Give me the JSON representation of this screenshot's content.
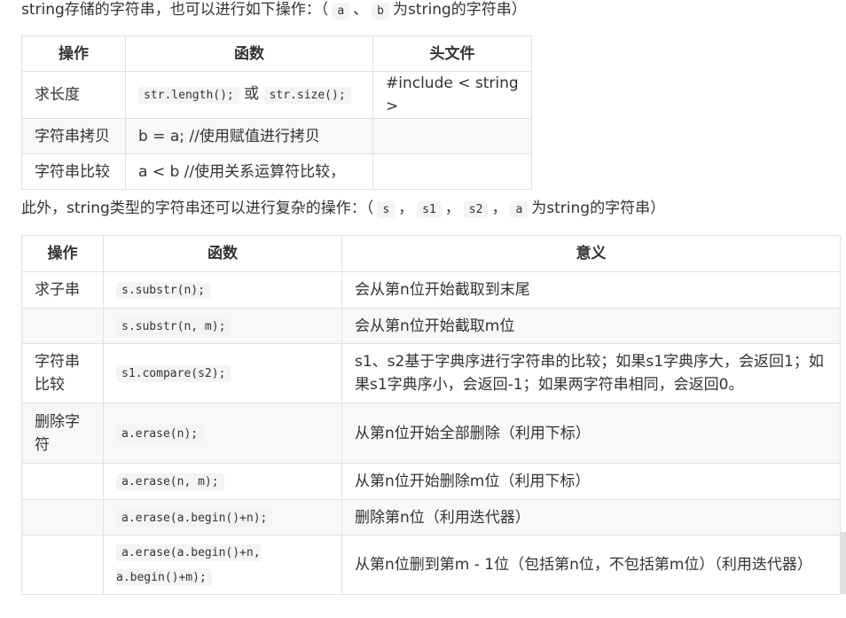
{
  "intro1": {
    "before": "string存储的字符串，也可以进行如下操作：（",
    "code_a": "a",
    "sep": "、",
    "code_b": "b",
    "after": "为string的字符串）"
  },
  "table1": {
    "headers": [
      "操作",
      "函数",
      "头文件"
    ],
    "rows": [
      {
        "op": "求长度",
        "code1": "str.length();",
        "or": "或",
        "code2": "str.size();",
        "header": "#include < string >"
      },
      {
        "op": "字符串拷贝",
        "func": "b = a; //使用赋值进行拷贝",
        "header": ""
      },
      {
        "op": "字符串比较",
        "func": "a < b //使用关系运算符比较，",
        "header": ""
      }
    ]
  },
  "intro2": {
    "before": "此外，string类型的字符串还可以进行复杂的操作：（",
    "code_s": "s",
    "comma1": "，",
    "code_s1": "s1",
    "comma2": "，",
    "code_s2": "s2",
    "comma3": "，",
    "code_a": "a",
    "after": "为string的字符串）"
  },
  "table2": {
    "headers": [
      "操作",
      "函数",
      "意义"
    ],
    "rows": [
      {
        "op": "求子串",
        "func": "s.substr(n);",
        "meaning": "会从第n位开始截取到末尾"
      },
      {
        "op": "",
        "func": "s.substr(n, m);",
        "meaning": "会从第n位开始截取m位"
      },
      {
        "op": "字符串比较",
        "func": "s1.compare(s2);",
        "meaning": "s1、s2基于字典序进行字符串的比较；如果s1字典序大，会返回1；如果s1字典序小，会返回-1；如果两字符串相同，会返回0。"
      },
      {
        "op": "删除字符",
        "func": "a.erase(n);",
        "meaning": "从第n位开始全部删除（利用下标）"
      },
      {
        "op": "",
        "func": "a.erase(n, m);",
        "meaning": "从第n位开始删除m位（利用下标）"
      },
      {
        "op": "",
        "func": "a.erase(a.begin()+n);",
        "meaning": "删除第n位（利用迭代器）"
      },
      {
        "op": "",
        "func": "a.erase(a.begin()+n, a.begin()+m);",
        "meaning": "从第n位删到第m - 1位（包括第n位，不包括第m位）（利用迭代器）"
      }
    ]
  }
}
